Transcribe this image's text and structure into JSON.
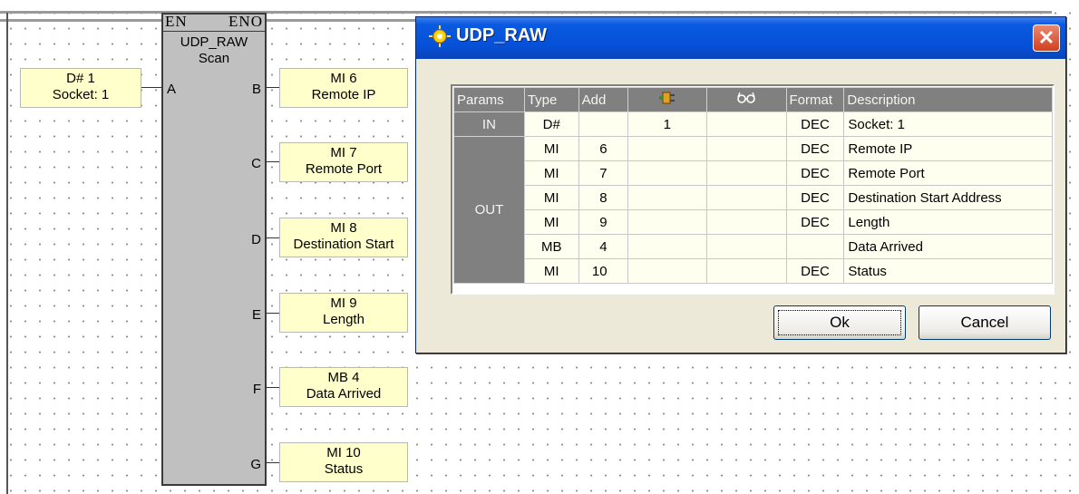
{
  "function_block": {
    "en_label": "EN",
    "eno_label": "ENO",
    "name": "UDP_RAW",
    "subtitle": "Scan",
    "pins": [
      "A",
      "B",
      "C",
      "D",
      "E",
      "F",
      "G"
    ]
  },
  "input_operand": {
    "address": "D# 1",
    "description": "Socket: 1"
  },
  "output_operands": [
    {
      "pin": "B",
      "address": "MI 6",
      "description": "Remote IP"
    },
    {
      "pin": "C",
      "address": "MI 7",
      "description": "Remote Port"
    },
    {
      "pin": "D",
      "address": "MI 8",
      "description": "Destination Start"
    },
    {
      "pin": "E",
      "address": "MI 9",
      "description": "Length"
    },
    {
      "pin": "F",
      "address": "MB 4",
      "description": "Data Arrived"
    },
    {
      "pin": "G",
      "address": "MI 10",
      "description": "Status"
    }
  ],
  "dialog": {
    "title": "UDP_RAW",
    "close_label": "✕",
    "headers": [
      "Params",
      "Type",
      "Add",
      "",
      "",
      "Format",
      "Description"
    ],
    "header_icons": [
      "plug-icon",
      "glasses-icon"
    ],
    "groups": {
      "in": "IN",
      "out": "OUT"
    },
    "rows": [
      {
        "type": "D#",
        "add": "",
        "value": "1",
        "format": "DEC",
        "description": "Socket: 1"
      },
      {
        "type": "MI",
        "add": "6",
        "value": "",
        "format": "DEC",
        "description": "Remote IP"
      },
      {
        "type": "MI",
        "add": "7",
        "value": "",
        "format": "DEC",
        "description": "Remote Port"
      },
      {
        "type": "MI",
        "add": "8",
        "value": "",
        "format": "DEC",
        "description": "Destination Start Address"
      },
      {
        "type": "MI",
        "add": "9",
        "value": "",
        "format": "DEC",
        "description": "Length"
      },
      {
        "type": "MB",
        "add": "4",
        "value": "",
        "format": "",
        "description": "Data Arrived"
      },
      {
        "type": "MI",
        "add": "10",
        "value": "",
        "format": "DEC",
        "description": "Status"
      }
    ],
    "ok_label": "Ok",
    "cancel_label": "Cancel"
  }
}
